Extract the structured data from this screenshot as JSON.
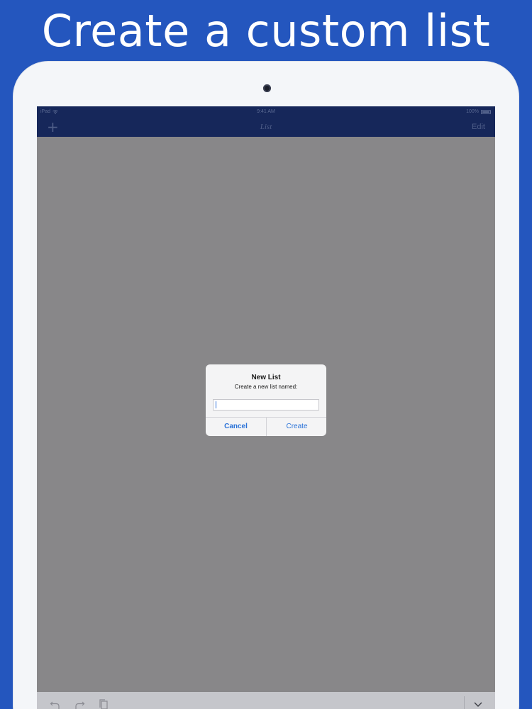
{
  "headline": "Create a custom list",
  "status_bar": {
    "carrier": "iPad",
    "time": "9:41 AM",
    "battery": "100%"
  },
  "nav_bar": {
    "add_icon": "plus-icon",
    "title": "List",
    "edit_label": "Edit"
  },
  "dialog": {
    "title": "New List",
    "message": "Create a new list named:",
    "input_value": "",
    "cancel_label": "Cancel",
    "create_label": "Create"
  },
  "toolbar": {
    "icons": [
      "undo-icon",
      "redo-icon",
      "paste-icon",
      "keyboard-dismiss-icon"
    ]
  },
  "colors": {
    "background": "#2456be",
    "nav_bar": "#16275a",
    "dim_overlay": "#888789",
    "accent": "#2a72d8"
  }
}
